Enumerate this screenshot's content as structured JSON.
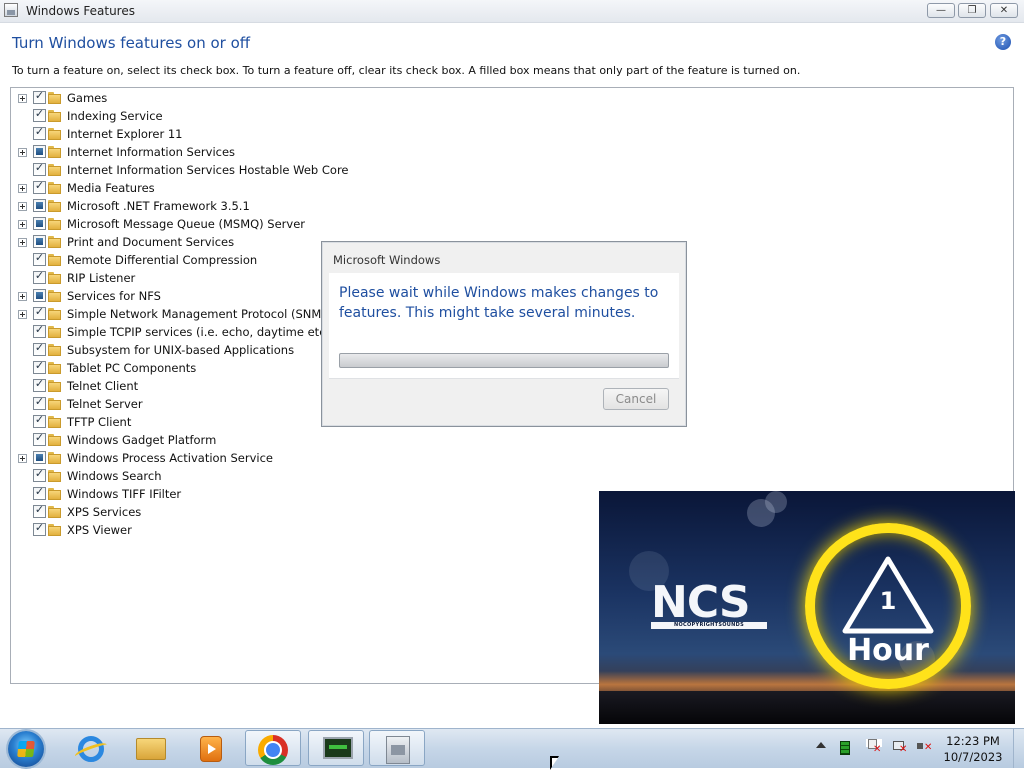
{
  "window": {
    "title": "Windows Features",
    "minimize_glyph": "—",
    "maximize_glyph": "❐",
    "close_glyph": "✕",
    "heading": "Turn Windows features on or off",
    "help_glyph": "?",
    "instructions": "To turn a feature on, select its check box. To turn a feature off, clear its check box. A filled box means that only part of the feature is turned on."
  },
  "features": [
    {
      "label": "Games",
      "state": "checked",
      "expandable": true
    },
    {
      "label": "Indexing Service",
      "state": "checked",
      "expandable": false
    },
    {
      "label": "Internet Explorer 11",
      "state": "checked",
      "expandable": false
    },
    {
      "label": "Internet Information Services",
      "state": "partial",
      "expandable": true
    },
    {
      "label": "Internet Information Services Hostable Web Core",
      "state": "checked",
      "expandable": false
    },
    {
      "label": "Media Features",
      "state": "checked",
      "expandable": true
    },
    {
      "label": "Microsoft .NET Framework 3.5.1",
      "state": "partial",
      "expandable": true
    },
    {
      "label": "Microsoft Message Queue (MSMQ) Server",
      "state": "partial",
      "expandable": true
    },
    {
      "label": "Print and Document Services",
      "state": "partial",
      "expandable": true
    },
    {
      "label": "Remote Differential Compression",
      "state": "checked",
      "expandable": false
    },
    {
      "label": "RIP Listener",
      "state": "checked",
      "expandable": false
    },
    {
      "label": "Services for NFS",
      "state": "partial",
      "expandable": true
    },
    {
      "label": "Simple Network Management Protocol (SNMP)",
      "state": "checked",
      "expandable": true
    },
    {
      "label": "Simple TCPIP services (i.e. echo, daytime etc)",
      "state": "checked",
      "expandable": false
    },
    {
      "label": "Subsystem for UNIX-based Applications",
      "state": "checked",
      "expandable": false
    },
    {
      "label": "Tablet PC Components",
      "state": "checked",
      "expandable": false
    },
    {
      "label": "Telnet Client",
      "state": "checked",
      "expandable": false
    },
    {
      "label": "Telnet Server",
      "state": "checked",
      "expandable": false
    },
    {
      "label": "TFTP Client",
      "state": "checked",
      "expandable": false
    },
    {
      "label": "Windows Gadget Platform",
      "state": "checked",
      "expandable": false
    },
    {
      "label": "Windows Process Activation Service",
      "state": "partial",
      "expandable": true
    },
    {
      "label": "Windows Search",
      "state": "checked",
      "expandable": false
    },
    {
      "label": "Windows TIFF IFilter",
      "state": "checked",
      "expandable": false
    },
    {
      "label": "XPS Services",
      "state": "checked",
      "expandable": false
    },
    {
      "label": "XPS Viewer",
      "state": "checked",
      "expandable": false
    }
  ],
  "dialog": {
    "title": "Microsoft Windows",
    "message": "Please wait while Windows makes changes to features. This might take several minutes.",
    "progress": 0,
    "cancel_label": "Cancel"
  },
  "video": {
    "logo_text": "NCS",
    "logo_subtext": "NOCOPYRIGHTSOUNDS",
    "badge_number": "1",
    "badge_text": "Hour",
    "ring_color": "#ffe21a"
  },
  "taskbar": {
    "apps": [
      {
        "name": "internet-explorer",
        "icon": "ie-icon",
        "active": false
      },
      {
        "name": "windows-explorer",
        "icon": "explorer-icon",
        "active": false
      },
      {
        "name": "media-player",
        "icon": "media-icon",
        "active": false
      },
      {
        "name": "chrome",
        "icon": "chrome-icon",
        "active": true
      },
      {
        "name": "system-monitor",
        "icon": "monitor-icon",
        "active": true
      },
      {
        "name": "windows-features",
        "icon": "features-icon",
        "active": true
      }
    ],
    "clock_time": "12:23 PM",
    "clock_date": "10/7/2023"
  },
  "colors": {
    "heading": "#1f4fa0",
    "taskbar": "#c6d6e8",
    "partial_check": "#1f4f82"
  }
}
